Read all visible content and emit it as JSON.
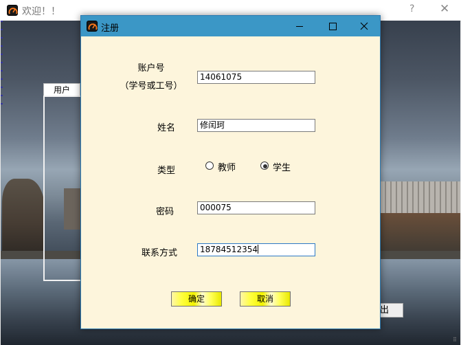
{
  "background_window": {
    "title": "欢迎！！",
    "help_label": "?",
    "close_label": "✕",
    "tab_label": "用户",
    "exit_button_label": "出"
  },
  "dialog": {
    "title": "注册",
    "fields": {
      "account_label_line1": "账户号",
      "account_label_line2": "（学号或工号）",
      "account_value": "14061075",
      "name_label": "姓名",
      "name_value": "修闰珂",
      "type_label": "类型",
      "type_option_teacher": "教师",
      "type_option_student": "学生",
      "type_selected": "学生",
      "password_label": "密码",
      "password_value": "000075",
      "contact_label": "联系方式",
      "contact_value": "18784512354"
    },
    "confirm_label": "确定",
    "cancel_label": "取消"
  },
  "colors": {
    "dialog_titlebar": "#3b97c6",
    "dialog_body": "#fdf5dc",
    "button_gradient_main": "#ffff40"
  },
  "icons": {
    "app_logo": "gauge-logo-icon",
    "minimize": "minimize-icon",
    "maximize": "maximize-icon",
    "close": "close-icon",
    "resize_grip": "resize-grip-icon"
  }
}
